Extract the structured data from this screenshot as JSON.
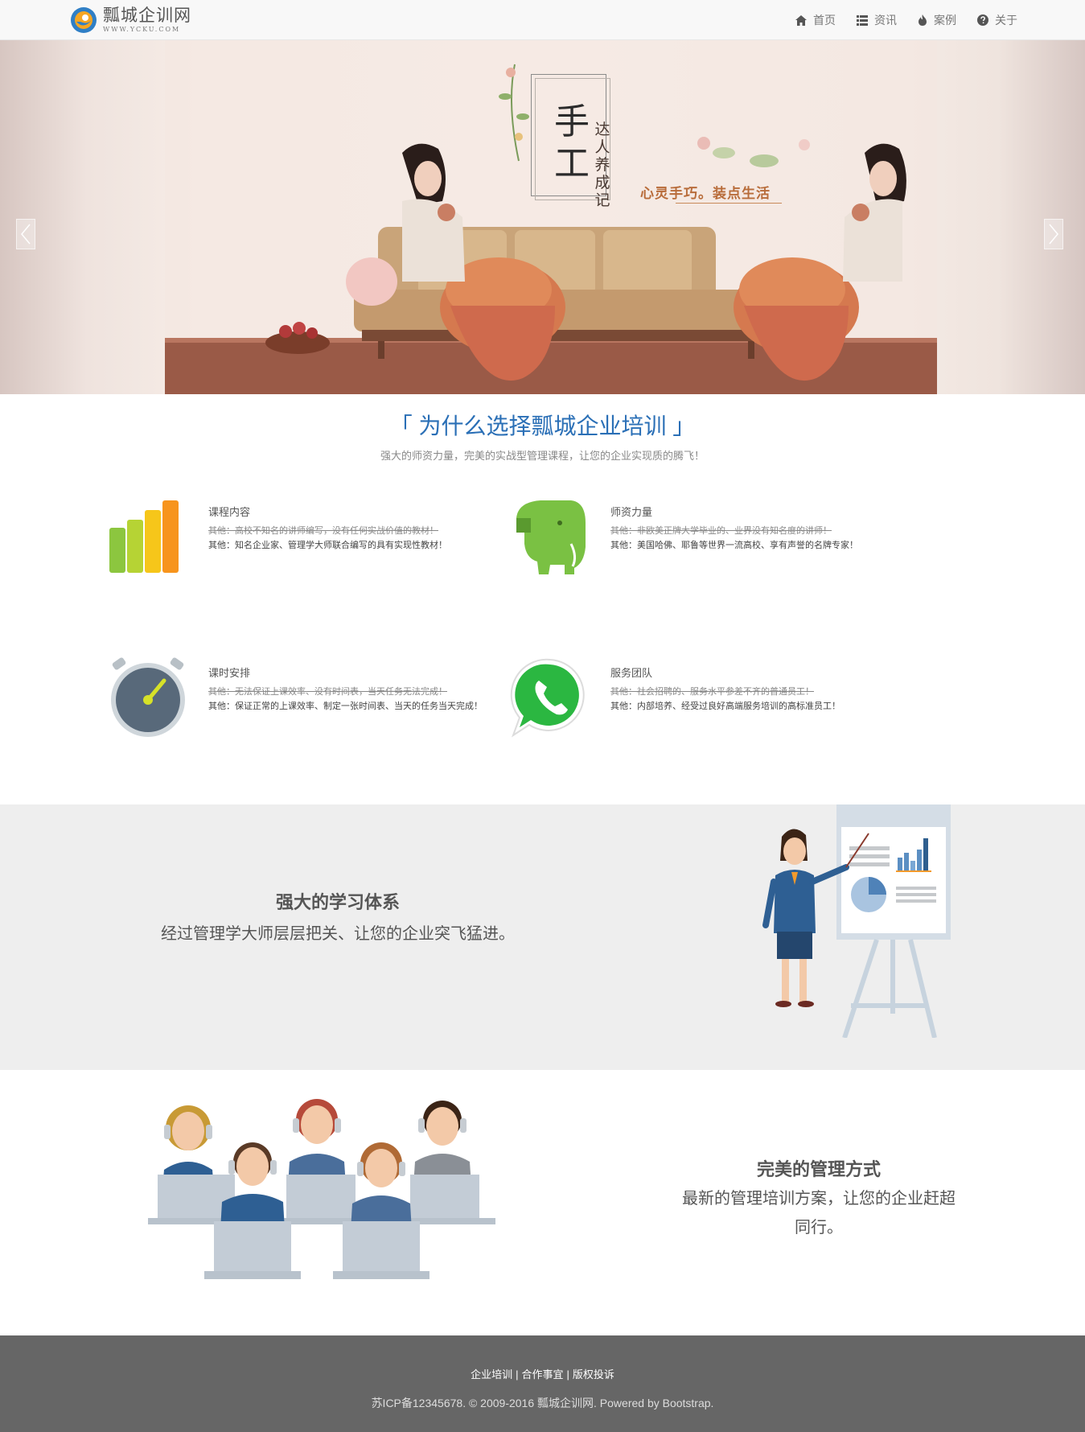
{
  "brand": {
    "name": "瓢城企训网",
    "url": "WWW.YCKU.COM"
  },
  "nav": [
    {
      "label": "首页",
      "icon": "home-icon"
    },
    {
      "label": "资讯",
      "icon": "list-icon"
    },
    {
      "label": "案例",
      "icon": "fire-icon"
    },
    {
      "label": "关于",
      "icon": "question-circle-icon"
    }
  ],
  "banner": {
    "title_main": "手工",
    "title_sub": "达人养成记",
    "slogan": "心灵手巧。装点生活"
  },
  "why": {
    "title": "「 为什么选择瓢城企业培训 」",
    "subtitle": "强大的师资力量，完美的实战型管理课程，让您的企业实现质的腾飞！",
    "features": [
      {
        "icon": "bar-chart-icon",
        "title": "课程内容",
        "strike": "其他：高校不知名的讲师编写，没有任何实战价值的教材！",
        "desc": "其他：知名企业家、管理学大师联合编写的具有实现性教材！"
      },
      {
        "icon": "elephant-icon",
        "title": "师资力量",
        "strike": "其他：非欧美正牌大学毕业的、业界没有知名度的讲师！",
        "desc": "其他：美国哈佛、耶鲁等世界一流高校、享有声誉的名牌专家！"
      },
      {
        "icon": "stopwatch-icon",
        "title": "课时安排",
        "strike": "其他：无法保证上课效率、没有时间表，当天任务无法完成！",
        "desc": "其他：保证正常的上课效率、制定一张时间表、当天的任务当天完成！"
      },
      {
        "icon": "phone-chat-icon",
        "title": "服务团队",
        "strike": "其他：社会招聘的、服务水平参差不齐的普通员工！",
        "desc": "其他：内部培养、经受过良好高端服务培训的高标准员工！"
      }
    ]
  },
  "system": {
    "title": "强大的学习体系",
    "desc": "经过管理学大师层层把关、让您的企业突飞猛进。"
  },
  "management": {
    "title": "完美的管理方式",
    "desc": "最新的管理培训方案，让您的企业赶超同行。"
  },
  "footer": {
    "links": [
      "企业培训",
      "合作事宜",
      "版权投诉"
    ],
    "copyright": "苏ICP备12345678. © 2009-2016 瓢城企训网. Powered by Bootstrap."
  },
  "colors": {
    "accent": "#2a6fb6",
    "footer_bg": "#666666",
    "section_bg": "#eeeeee",
    "navbar_bg": "#f8f8f8"
  }
}
